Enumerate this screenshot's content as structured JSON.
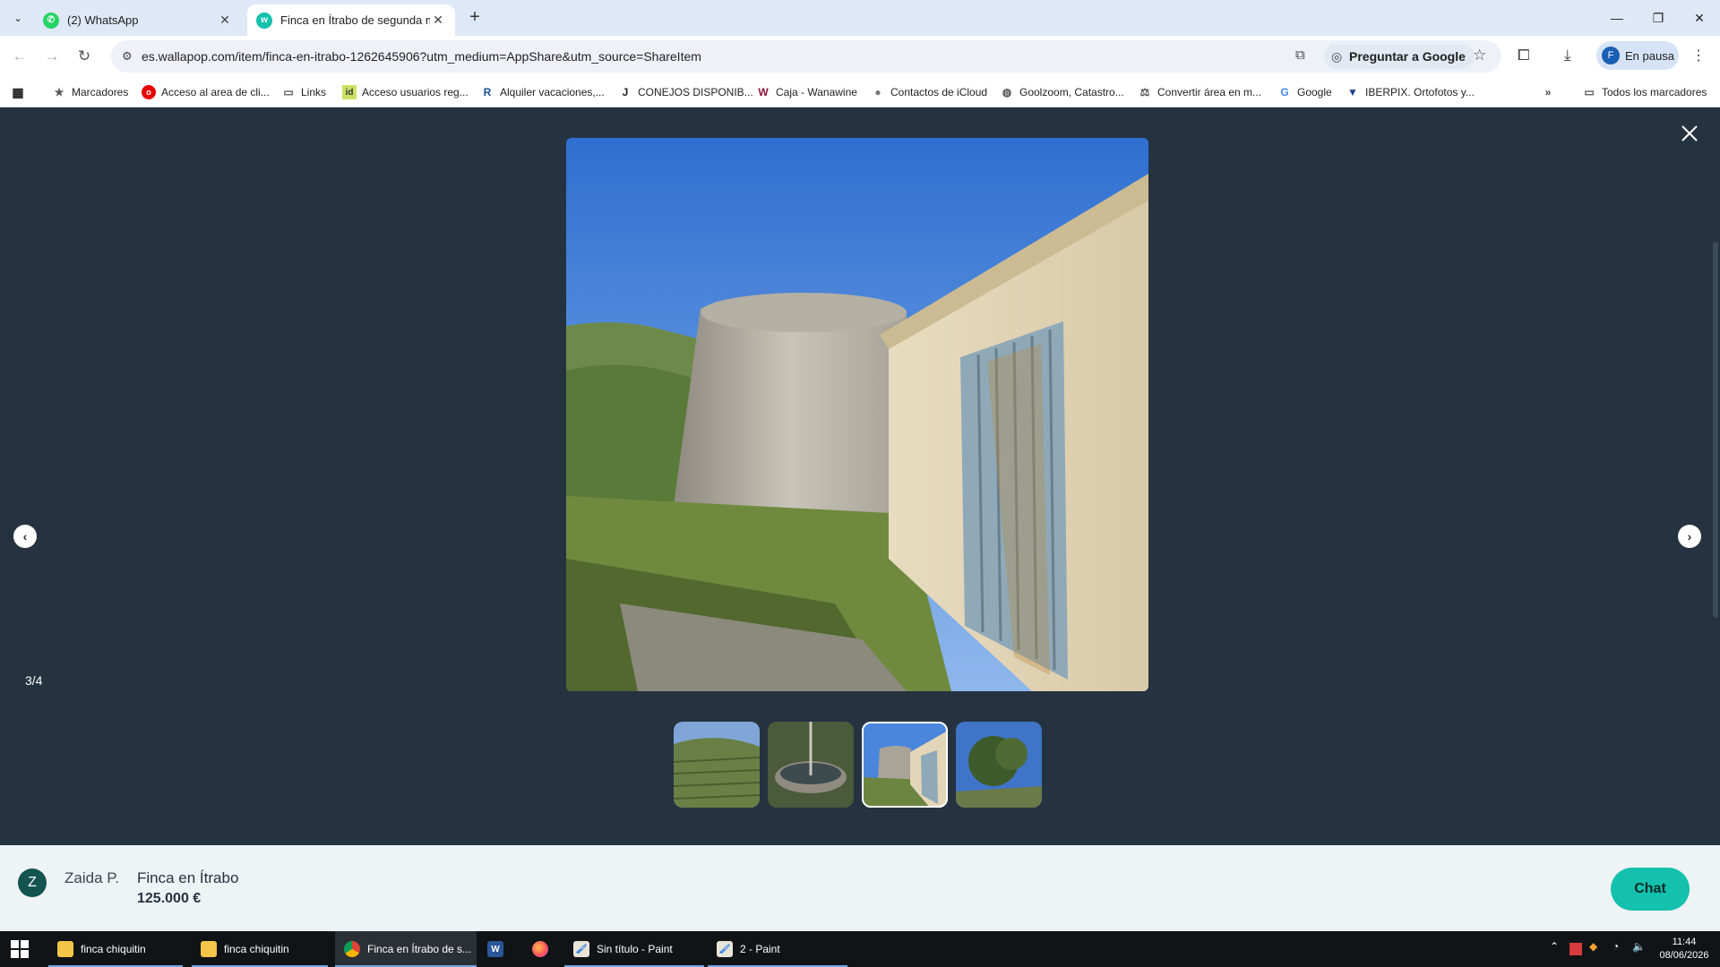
{
  "browser": {
    "tabs": [
      {
        "title": "(2) WhatsApp",
        "icon": "whatsapp-icon"
      },
      {
        "title": "Finca en Ítrabo de segunda mano",
        "icon": "wallapop-icon"
      }
    ],
    "url": "es.wallapop.com/item/finca-en-itrabo-1262645906?utm_medium=AppShare&utm_source=ShareItem",
    "ask_google": "Preguntar a Google",
    "profile_initial": "F",
    "profile_label": "En pausa"
  },
  "bookmarks": [
    {
      "label": "Marcadores",
      "icon": "star-icon"
    },
    {
      "label": "Acceso al area de cli...",
      "icon": "vodafone-icon"
    },
    {
      "label": "Links",
      "icon": "folder-icon"
    },
    {
      "label": "Acceso usuarios reg...",
      "icon": "id-icon"
    },
    {
      "label": "Alquiler vacaciones,...",
      "icon": "r-icon"
    },
    {
      "label": "CONEJOS DISPONIB...",
      "icon": "j-icon"
    },
    {
      "label": "Caja - Wanawine",
      "icon": "w-icon"
    },
    {
      "label": "Contactos de iCloud",
      "icon": "apple-icon"
    },
    {
      "label": "Goolzoom, Catastro...",
      "icon": "globe-icon"
    },
    {
      "label": "Convertir área en m...",
      "icon": "converter-icon"
    },
    {
      "label": "Google",
      "icon": "google-icon"
    },
    {
      "label": "IBERPIX. Ortofotos y...",
      "icon": "iberpix-icon"
    }
  ],
  "all_bookmarks": "Todos los marcadores",
  "viewer": {
    "counter": "3/4",
    "selected_index": 2,
    "thumbnail_count": 4
  },
  "listing": {
    "seller_initial": "Z",
    "seller_name": "Zaida P.",
    "title": "Finca en Ítrabo",
    "price": "125.000 €",
    "chat_label": "Chat"
  },
  "taskbar": {
    "items": [
      {
        "label": "finca chiquitin",
        "icon": "folder-icon"
      },
      {
        "label": "finca chiquitin",
        "icon": "folder-icon"
      },
      {
        "label": "Finca en Ítrabo de s...",
        "icon": "chrome-icon"
      },
      {
        "label": "",
        "icon": "word-icon"
      },
      {
        "label": "",
        "icon": "firefox-icon"
      },
      {
        "label": "Sin título - Paint",
        "icon": "paint-icon"
      },
      {
        "label": "2 - Paint",
        "icon": "paint-icon"
      }
    ],
    "time": "11:44",
    "date": "08/06/2026"
  },
  "colors": {
    "viewer_bg": "#253340",
    "accent": "#13c1ac",
    "footer_bg": "#eef3f6"
  }
}
